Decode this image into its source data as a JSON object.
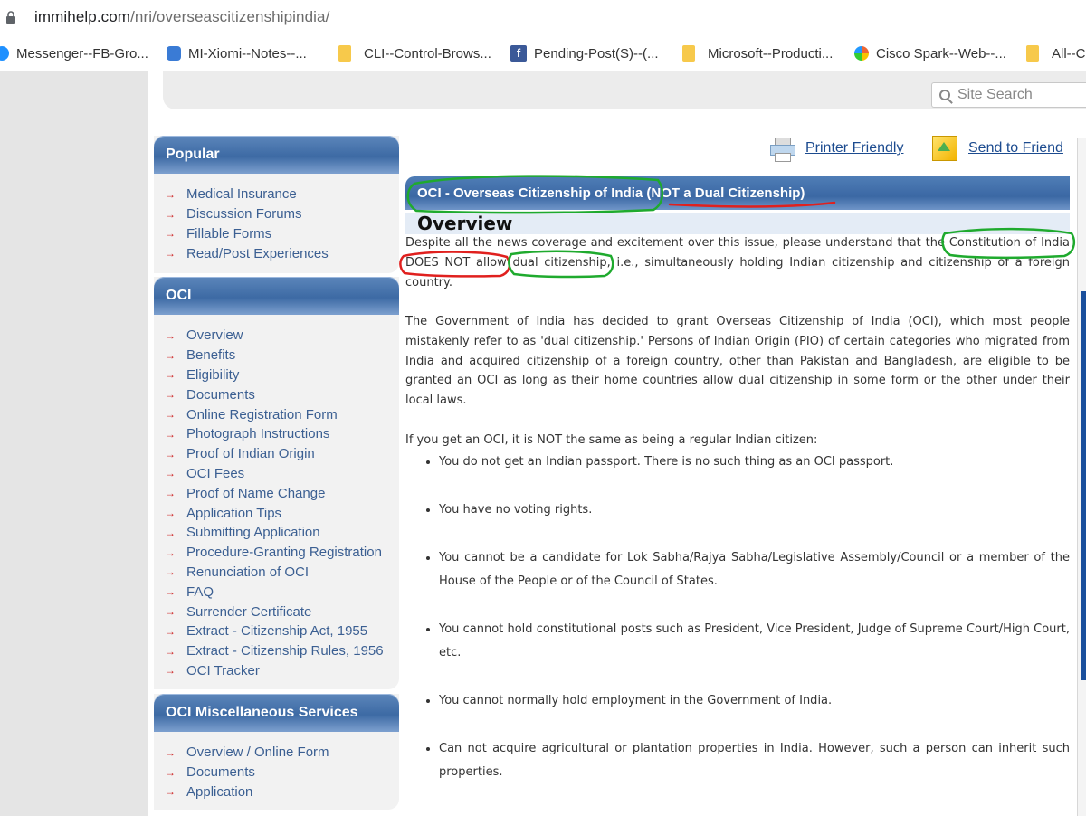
{
  "browser": {
    "url_host": "immihelp.com",
    "url_path": "/nri/overseascitizenshipindia/",
    "bookmarks": [
      {
        "label": "Messenger--FB-Gro...",
        "icon": "messenger-icon"
      },
      {
        "label": "MI-Xiomi--Notes--...",
        "icon": "cloud-icon"
      },
      {
        "label": "CLI--Control-Brows...",
        "icon": "folder-icon"
      },
      {
        "label": "Pending-Post(S)--(...",
        "icon": "facebook-icon"
      },
      {
        "label": "Microsoft--Producti...",
        "icon": "folder-icon"
      },
      {
        "label": "Cisco Spark--Web--...",
        "icon": "webex-icon"
      },
      {
        "label": "All--C",
        "icon": "folder-icon"
      }
    ]
  },
  "search": {
    "placeholder": "Site Search"
  },
  "sidebar": {
    "popular": {
      "title": "Popular",
      "items": [
        "Medical Insurance",
        "Discussion Forums",
        "Fillable Forms",
        "Read/Post Experiences"
      ]
    },
    "oci": {
      "title": "OCI",
      "items": [
        "Overview",
        "Benefits",
        "Eligibility",
        "Documents",
        "Online Registration Form",
        "Photograph Instructions",
        "Proof of Indian Origin",
        "OCI Fees",
        "Proof of Name Change",
        "Application Tips",
        "Submitting Application",
        "Procedure-Granting Registration",
        "Renunciation of OCI",
        "FAQ",
        "Surrender Certificate",
        "Extract - Citizenship Act, 1955",
        "Extract - Citizenship Rules, 1956",
        "OCI Tracker"
      ]
    },
    "misc": {
      "title": "OCI Miscellaneous Services",
      "items": [
        "Overview / Online Form",
        "Documents",
        "Application"
      ]
    },
    "arrow": "→"
  },
  "tools": {
    "printer": "Printer Friendly",
    "send": "Send to Friend"
  },
  "article": {
    "title_main": "OCI - Overseas Citizenship of India",
    "title_note": "(NOT a Dual Citizenship)",
    "heading": "Overview",
    "p1_before": "Despite all the news coverage and excitement over this issue, please understand that the",
    "p1_constitution": "Constitution of India",
    "p1_does_not": "DOES NOT allow",
    "p1_dual": "dual citizenship,",
    "p1_after": "i.e., simultaneously holding Indian citizenship and citizenship of a foreign country.",
    "p2": "The Government of India has decided to grant Overseas Citizenship of India (OCI), which most people mistakenly refer to as 'dual citizenship.' Persons of Indian Origin (PIO) of certain categories who migrated from India and acquired citizenship of a foreign country, other than Pakistan and Bangladesh, are eligible to be granted an OCI as long as their home countries allow dual citizenship in some form or the other under their local laws.",
    "p3": "If you get an OCI, it is NOT the same as being a regular Indian citizen:",
    "bullets": [
      "You do not get an Indian passport. There is no such thing as an OCI passport.",
      "You have no voting rights.",
      "You cannot be a candidate for Lok Sabha/Rajya Sabha/Legislative Assembly/Council or a member of the House of the People or of the Council of States.",
      "You cannot hold constitutional posts such as President, Vice President, Judge of Supreme Court/High Court, etc.",
      "You cannot normally hold employment in the Government of India.",
      "Can not acquire agricultural or plantation properties in India. However, such a person can inherit such properties."
    ]
  },
  "colors": {
    "panel_blue": "#3d6aa4",
    "link_blue": "#3b5f92",
    "arrow_red": "#cc2222",
    "marker_green": "#1faa2e",
    "marker_red": "#e0201e"
  }
}
